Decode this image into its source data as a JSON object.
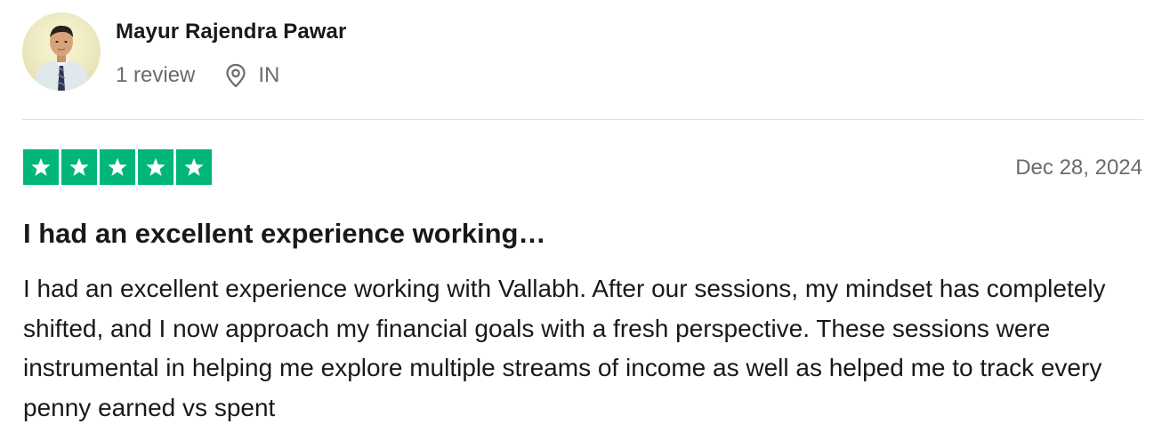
{
  "consumer": {
    "name": "Mayur Rajendra Pawar",
    "review_count": "1 review",
    "country": "IN"
  },
  "review": {
    "rating": 5,
    "rating_max": 5,
    "star_color": "#00b67a",
    "date": "Dec 28, 2024",
    "title": "I had an excellent experience working…",
    "body": "I had an excellent experience working with Vallabh. After our sessions, my mindset has completely shifted, and I now approach my financial goals with a fresh perspective. These sessions were instrumental in helping me explore multiple streams of income as well as helped me to track every penny earned vs spent"
  },
  "icons": {
    "location": "map-pin-icon",
    "star": "star-icon"
  }
}
